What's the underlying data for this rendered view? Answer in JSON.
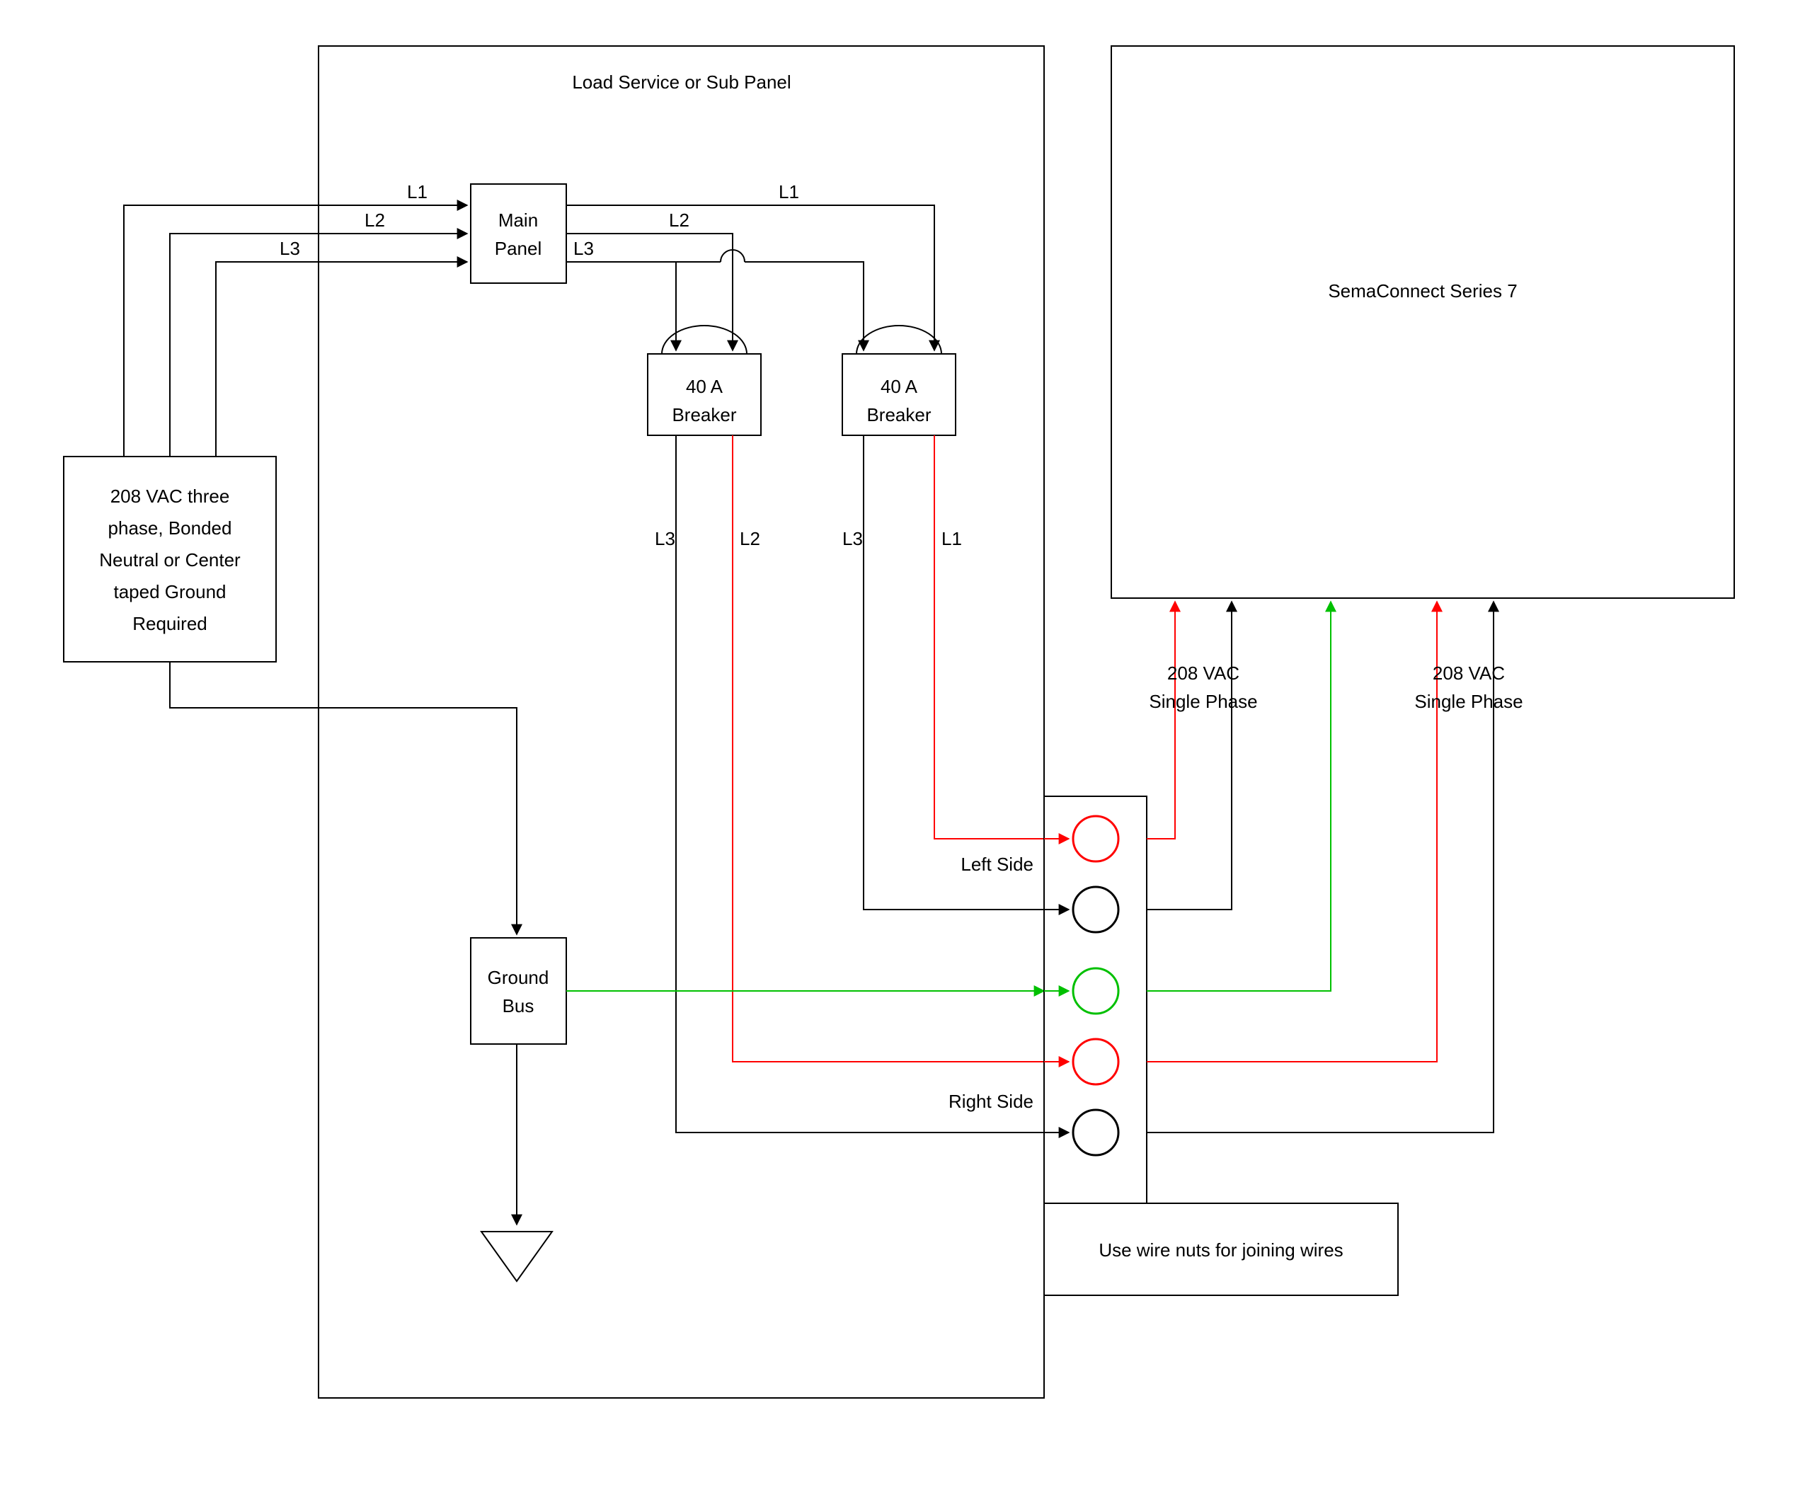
{
  "panel": {
    "title": "Load Service or Sub Panel"
  },
  "source": {
    "l1": "208 VAC three",
    "l2": "phase, Bonded",
    "l3": "Neutral or Center",
    "l4": "taped Ground",
    "l5": "Required"
  },
  "mainPanel": {
    "l1": "Main",
    "l2": "Panel"
  },
  "breaker1": {
    "amp": "40 A",
    "label": "Breaker"
  },
  "breaker2": {
    "amp": "40 A",
    "label": "Breaker"
  },
  "groundBus": {
    "l1": "Ground",
    "l2": "Bus"
  },
  "phases": {
    "l1": "L1",
    "l2": "L2",
    "l3": "L3"
  },
  "leftSide": "Left Side",
  "rightSide": "Right Side",
  "sema": "SemaConnect Series 7",
  "vac1": {
    "l1": "208 VAC",
    "l2": "Single Phase"
  },
  "vac2": {
    "l1": "208 VAC",
    "l2": "Single Phase"
  },
  "note": "Use wire nuts for joining wires"
}
